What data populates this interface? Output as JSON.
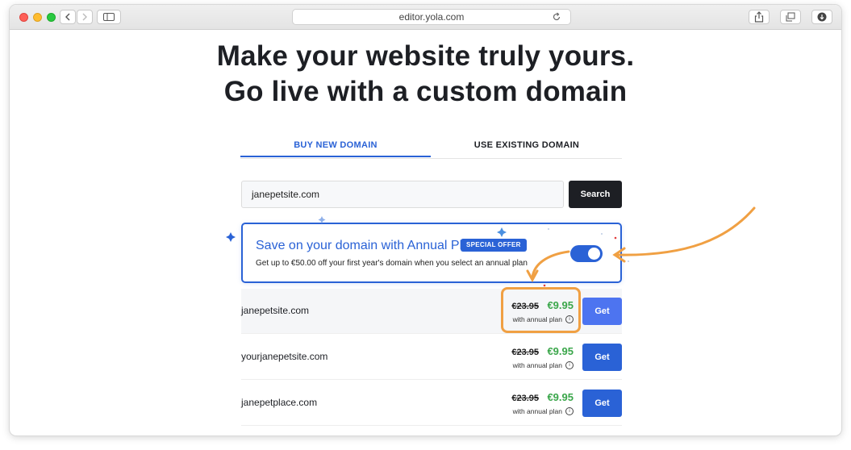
{
  "browser": {
    "url": "editor.yola.com"
  },
  "headline": {
    "line1": "Make your website truly yours.",
    "line2": "Go live with a custom domain"
  },
  "tabs": [
    {
      "label": "BUY NEW DOMAIN",
      "active": true
    },
    {
      "label": "USE EXISTING DOMAIN",
      "active": false
    }
  ],
  "search": {
    "value": "janepetsite.com",
    "button_label": "Search"
  },
  "offer": {
    "title": "Save on your domain with Annual Plan",
    "badge": "SPECIAL OFFER",
    "subtitle": "Get up to €50.00 off your first year's domain when you select an annual plan",
    "toggle_on": true
  },
  "results": [
    {
      "domain": "janepetsite.com",
      "old_price": "€23.95",
      "new_price": "€9.95",
      "note": "with annual plan",
      "button": "Get"
    },
    {
      "domain": "yourjanepetsite.com",
      "old_price": "€23.95",
      "new_price": "€9.95",
      "note": "with annual plan",
      "button": "Get"
    },
    {
      "domain": "janepetplace.com",
      "old_price": "€23.95",
      "new_price": "€9.95",
      "note": "with annual plan",
      "button": "Get"
    }
  ],
  "colors": {
    "accent": "#2a62d6",
    "price_green": "#3aa64a",
    "annotation_orange": "#f0a043"
  }
}
